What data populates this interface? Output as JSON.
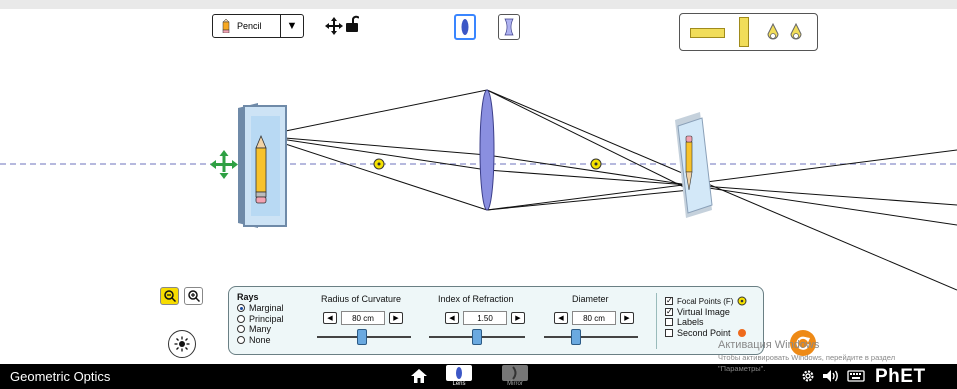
{
  "toolbar": {
    "object_selector": {
      "value": "Pencil",
      "icon": "pencil-icon"
    },
    "lens_toggle_icon": "convex-lens-icon",
    "concave_toggle_icon": "concave-lens-icon",
    "move_icon": "move-arrows-icon",
    "lock_icon": "unlock-icon"
  },
  "panel": {
    "rays": {
      "title": "Rays",
      "options": [
        "Marginal",
        "Principal",
        "Many",
        "None"
      ],
      "selected": "Marginal"
    },
    "radius": {
      "label": "Radius of Curvature",
      "value": "80 cm",
      "slider": 0.4
    },
    "index": {
      "label": "Index of Refraction",
      "value": "1.50",
      "slider": 0.5
    },
    "diameter": {
      "label": "Diameter",
      "value": "80 cm",
      "slider": 0.33
    },
    "checks": {
      "focal": {
        "label": "Focal Points (F)",
        "checked": true
      },
      "virtual": {
        "label": "Virtual Image",
        "checked": true
      },
      "labels": {
        "label": "Labels",
        "checked": false
      },
      "second": {
        "label": "Second Point",
        "checked": false
      }
    }
  },
  "navbar": {
    "title": "Geometric Optics",
    "tabs": [
      {
        "label": "Lens",
        "active": true
      },
      {
        "label": "Mirror",
        "active": false
      }
    ],
    "brand": "PhET"
  },
  "watermark": {
    "line1": "Активация Windows",
    "line2": "Чтобы активировать Windows, перейдите в раздел",
    "line3": "\"Параметры\"."
  },
  "colors": {
    "accent": "#3a86ff",
    "lens": "#8a8fe0",
    "focal": "#f5e200",
    "panel_bg": "#eef7f8",
    "navbar": "#000000"
  }
}
